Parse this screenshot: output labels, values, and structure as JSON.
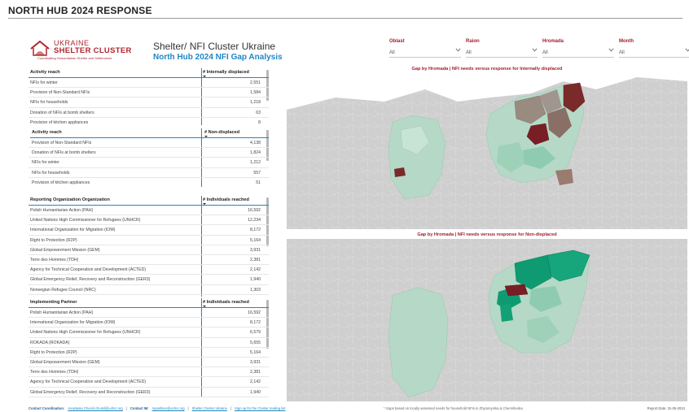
{
  "page": {
    "title": "NORTH HUB 2024 RESPONSE"
  },
  "logo": {
    "line1": "UKRAINE",
    "line2": "SHELTER CLUSTER",
    "line3": "Coordinating Humanitarian Shelter and Settlements",
    "color": "#b2262f"
  },
  "header": {
    "title": "Shelter/ NFI Cluster Ukraine",
    "subtitle": "North Hub 2024 NFI Gap Analysis"
  },
  "filters": [
    {
      "label": "Oblast",
      "value": "All"
    },
    {
      "label": "Raion",
      "value": "All"
    },
    {
      "label": "Hromada",
      "value": "All"
    },
    {
      "label": "Month",
      "value": "All"
    }
  ],
  "tables": {
    "idp": {
      "col1": "Activity reach",
      "col2": "# Internally displaced",
      "rows": [
        {
          "name": "NFIs for winter",
          "value": "2,551"
        },
        {
          "name": "Provision of Non-Standard NFIs",
          "value": "1,584"
        },
        {
          "name": "NFIs for households",
          "value": "1,218"
        },
        {
          "name": "Donation of NFIs at bomb shelters",
          "value": "63"
        },
        {
          "name": "Provision of kitchen appliances",
          "value": "8"
        }
      ]
    },
    "non_displaced": {
      "col1": "Activity reach",
      "col2": "# Non-displaced",
      "rows": [
        {
          "name": "Provision of Non-Standard NFIs",
          "value": "4,138"
        },
        {
          "name": "Donation of NFIs at bomb shelters",
          "value": "1,824"
        },
        {
          "name": "NFIs for winter",
          "value": "1,212"
        },
        {
          "name": "NFIs for households",
          "value": "557"
        },
        {
          "name": "Provision of kitchen appliances",
          "value": "51"
        }
      ]
    },
    "reporting": {
      "col1": "Reporting Organization Organization",
      "col2": "# Individuals reached",
      "rows": [
        {
          "name": "Polish Humanitarian Action (PAH)",
          "value": "16,592"
        },
        {
          "name": "United Nations High Commissioner for Refugees (UNHCR)",
          "value": "12,234"
        },
        {
          "name": "International Organization for Migration (IOM)",
          "value": "8,172"
        },
        {
          "name": "Right to Protection (R2P)",
          "value": "5,164"
        },
        {
          "name": "Global Empowerment Mission (GEM)",
          "value": "3,931"
        },
        {
          "name": "Terre des Hommes (TDH)",
          "value": "2,381"
        },
        {
          "name": "Agency for Technical Cooperation and Development (ACTED)",
          "value": "2,142"
        },
        {
          "name": "Global Emergency Relief, Recovery and Reconstruction (GER3)",
          "value": "1,940"
        },
        {
          "name": "Norwegian Refugee Council (NRC)",
          "value": "1,303"
        }
      ]
    },
    "implementing": {
      "col1": "Implementing Partner",
      "col2": "# Individuals reached",
      "rows": [
        {
          "name": "Polish Humanitarian Action (PAH)",
          "value": "16,592"
        },
        {
          "name": "International Organization for Migration (IOM)",
          "value": "8,172"
        },
        {
          "name": "United Nations High Commissioner for Refugees (UNHCR)",
          "value": "6,579"
        },
        {
          "name": "ROKADA (ROKADA)",
          "value": "5,655"
        },
        {
          "name": "Right to Protection (R2P)",
          "value": "5,164"
        },
        {
          "name": "Global Empowerment Mission (GEM)",
          "value": "3,931"
        },
        {
          "name": "Terre des Hommes (TDH)",
          "value": "2,381"
        },
        {
          "name": "Agency for Technical Cooperation and Development (ACTED)",
          "value": "2,142"
        },
        {
          "name": "Global Emergency Relief, Recovery and Reconstruction (GER3)",
          "value": "1,940"
        }
      ]
    }
  },
  "maps": {
    "idp_title": "Gap by Hromada | NFI needs versus response for Internally displaced",
    "nd_title": "Gap by Hromada | NFI needs versus response for Non-displaced"
  },
  "footer": {
    "contact_label": "Contact Coordination:",
    "contact_value": "Anastasia Chumil chumil@unhcr.org",
    "im_label": "Contact IM:",
    "im_value": "mpashine@unhcr.org",
    "link1": "Shelter Cluster Ukraine",
    "link2": "Sign up for the Cluster mailing list",
    "note": "* Gaps based on locally assessed needs for household NFIs in Zhytomyrska & Chernihivska",
    "date": "Report Date: 31-05-2024"
  },
  "colors": {
    "accent": "#1f88c7",
    "title_red": "#a11b2a",
    "map_bg": "#cfcfcf",
    "gap_dark": "#7a2a2a",
    "cover_light": "#b5d9c6",
    "cover_dark": "#0f9b72"
  }
}
